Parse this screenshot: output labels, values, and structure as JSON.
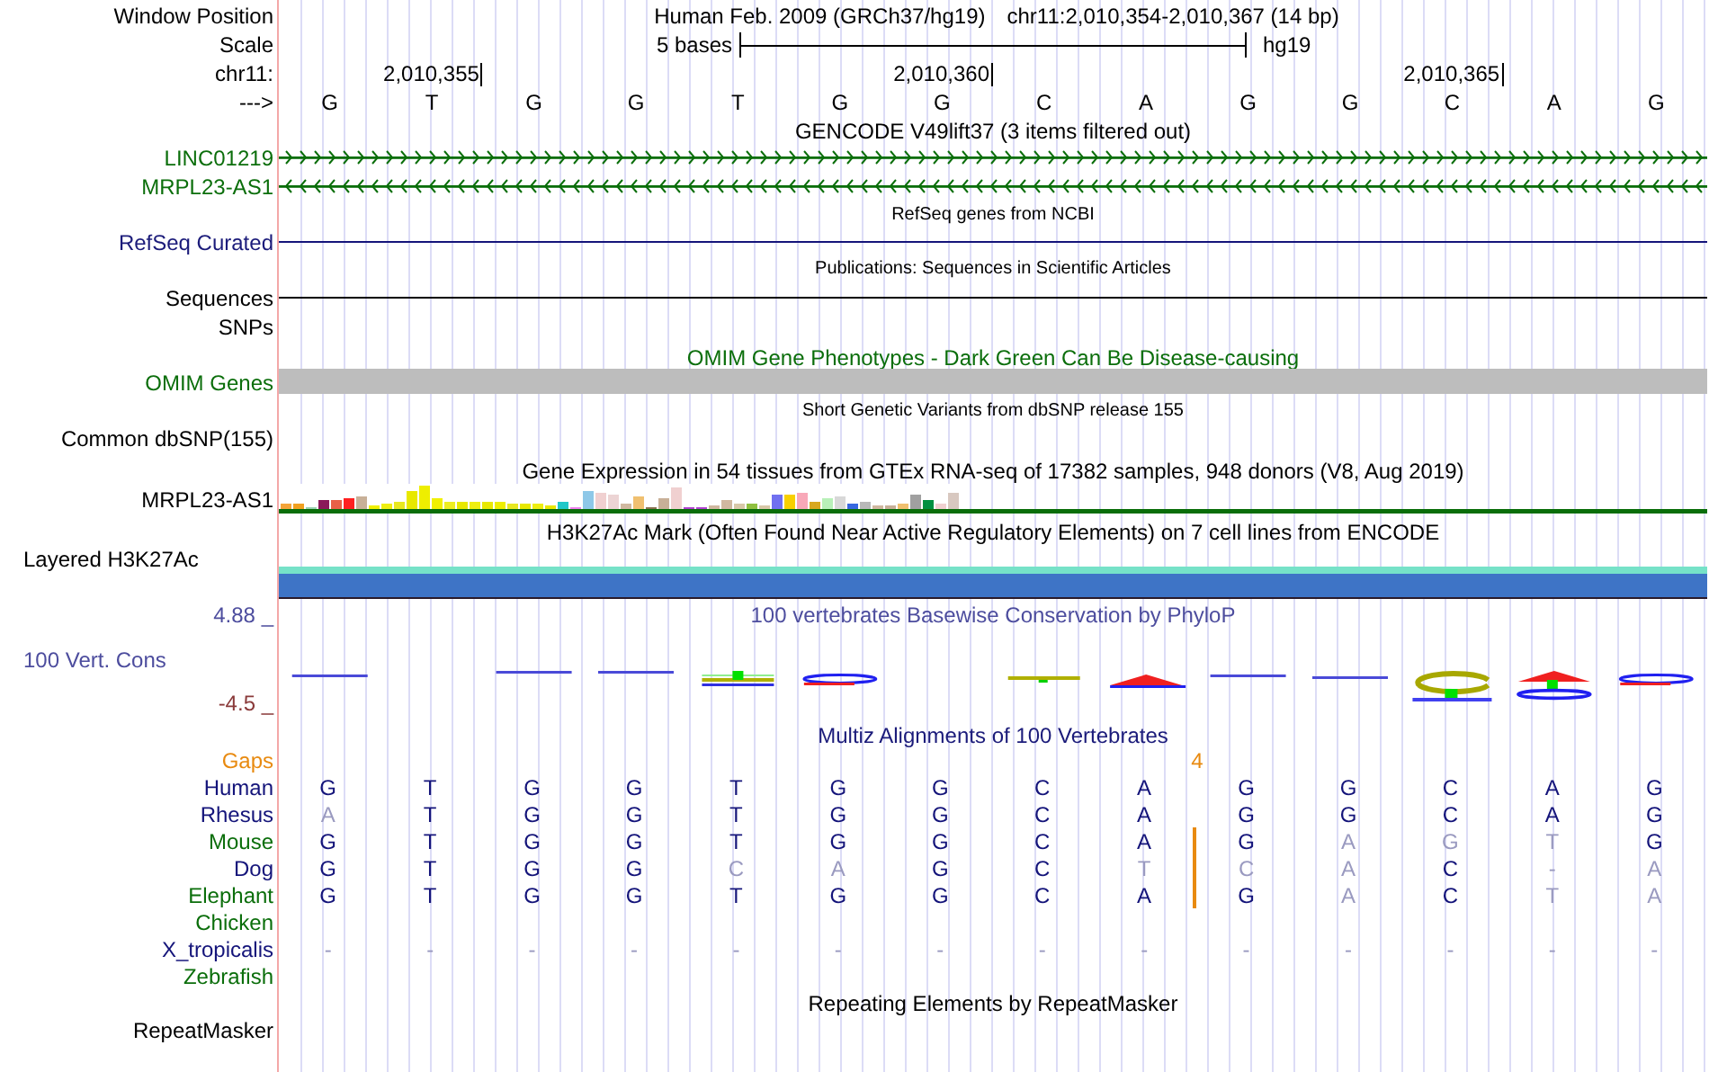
{
  "header": {
    "label": "Window Position",
    "assembly": "Human Feb. 2009 (GRCh37/hg19)",
    "position": "chr11:2,010,354-2,010,367 (14 bp)"
  },
  "scale": {
    "label": "Scale",
    "length": "5 bases",
    "assembly": "hg19"
  },
  "ruler": {
    "label": "chr11:",
    "ticks": [
      "2,010,355",
      "2,010,360",
      "2,010,365"
    ]
  },
  "sequence": {
    "label": "--->",
    "bases": [
      {
        "base": "G",
        "insertion": false
      },
      {
        "base": "T",
        "insertion": false
      },
      {
        "base": "G",
        "insertion": false
      },
      {
        "base": "G",
        "insertion": false
      },
      {
        "base": "T",
        "insertion": false
      },
      {
        "base": "G",
        "insertion": false
      },
      {
        "base": "G",
        "insertion": false
      },
      {
        "base": "C",
        "insertion": false
      },
      {
        "base": "A",
        "insertion": true
      },
      {
        "base": "G",
        "insertion": false
      },
      {
        "base": "G",
        "insertion": false
      },
      {
        "base": "C",
        "insertion": false
      },
      {
        "base": "A",
        "insertion": false
      },
      {
        "base": "G",
        "insertion": false
      }
    ]
  },
  "gencode": {
    "title": "GENCODE V49lift37 (3 items filtered out)",
    "genes": [
      {
        "name": "LINC01219",
        "forward": true
      },
      {
        "name": "MRPL23-AS1",
        "forward": false
      }
    ]
  },
  "refseq": {
    "title": "RefSeq genes from NCBI",
    "label": "RefSeq Curated"
  },
  "publications": {
    "title": "Publications: Sequences in Scientific Articles",
    "label": "Sequences"
  },
  "snps": {
    "label": "SNPs"
  },
  "omim": {
    "title": "OMIM Gene Phenotypes - Dark Green Can Be Disease-causing",
    "label": "OMIM Genes"
  },
  "dbsnp": {
    "title": "Short Genetic Variants from dbSNP release 155",
    "label": "Common dbSNP(155)"
  },
  "gtex": {
    "title": "Gene Expression in 54 tissues from GTEx RNA-seq of 17382 samples, 948 donors (V8, Aug 2019)",
    "label": "MRPL23-AS1"
  },
  "h3k27ac": {
    "title": "H3K27Ac Mark (Often Found Near Active Regulatory Elements) on 7 cell lines from ENCODE",
    "label": "Layered H3K27Ac"
  },
  "phylop": {
    "title": "100 vertebrates Basewise Conservation by PhyloP",
    "label": "100 Vert. Cons",
    "max": "4.88 _",
    "min": "-4.5 _"
  },
  "multiz": {
    "title": "Multiz Alignments of 100 Vertebrates",
    "gaps_label": "Gaps",
    "gap_count": "4",
    "species": [
      {
        "name": "Human",
        "color": "#14147a",
        "insertion": false,
        "bases": [
          "G",
          "T",
          "G",
          "G",
          "T",
          "G",
          "G",
          "C",
          "A",
          "G",
          "G",
          "C",
          "A",
          "G"
        ]
      },
      {
        "name": "Rhesus",
        "color": "#14147a",
        "insertion": false,
        "bases": [
          "A",
          "T",
          "G",
          "G",
          "T",
          "G",
          "G",
          "C",
          "A",
          "G",
          "G",
          "C",
          "A",
          "G"
        ]
      },
      {
        "name": "Mouse",
        "color": "#0b6e0b",
        "insertion": true,
        "bases": [
          "G",
          "T",
          "G",
          "G",
          "T",
          "G",
          "G",
          "C",
          "A",
          "G",
          "A",
          "G",
          "T",
          "G"
        ]
      },
      {
        "name": "Dog",
        "color": "#14147a",
        "insertion": true,
        "bases": [
          "G",
          "T",
          "G",
          "G",
          "C",
          "A",
          "G",
          "C",
          "T",
          "C",
          "A",
          "C",
          "-",
          "A"
        ]
      },
      {
        "name": "Elephant",
        "color": "#0b6e0b",
        "insertion": true,
        "bases": [
          "G",
          "T",
          "G",
          "G",
          "T",
          "G",
          "G",
          "C",
          "A",
          "G",
          "A",
          "C",
          "T",
          "A"
        ]
      },
      {
        "name": "Chicken",
        "color": "#0b6e0b"
      },
      {
        "name": "X_tropicalis",
        "color": "#14147a",
        "insertion": false,
        "bases": [
          "-",
          "-",
          "-",
          "-",
          "-",
          "-",
          "-",
          "-",
          "-",
          "-",
          "-",
          "-",
          "-",
          "-"
        ]
      },
      {
        "name": "Zebrafish",
        "color": "#0b6e0b"
      }
    ]
  },
  "repeatmasker": {
    "title": "Repeating Elements by RepeatMasker",
    "label": "RepeatMasker"
  }
}
